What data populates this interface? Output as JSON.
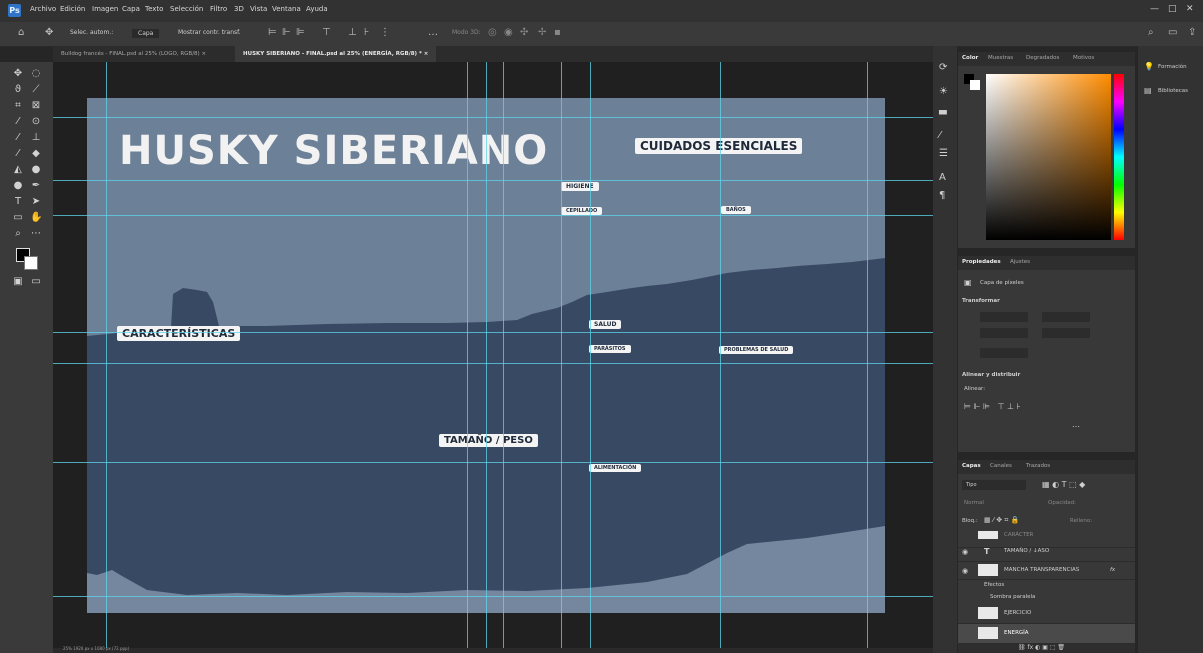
{
  "menu": [
    "Archivo",
    "Edición",
    "Imagen",
    "Capa",
    "Texto",
    "Selección",
    "Filtro",
    "3D",
    "Vista",
    "Ventana",
    "Ayuda"
  ],
  "window_controls": {
    "minimize": "—",
    "maximize": "□",
    "close": "✕"
  },
  "options_bar": {
    "auto_select_label": "Selec. autom.:",
    "auto_select_value": "Capa",
    "transform_controls_label": "Mostrar contr. transf.",
    "mode_3d_label": "Modo 3D:"
  },
  "tabs": [
    {
      "label": "Bulldog francés - FINAL.psd al 25% (LOGO, RGB/8)",
      "close": "×"
    },
    {
      "label": "HUSKY SIBERIANO - FINAL.psd al 25% (ENERGÍA, RGB/8) *",
      "close": "×"
    }
  ],
  "artboard": {
    "title": "HUSKY SIBERIANO",
    "labels": {
      "cuidados": "CUIDADOS ESENCIALES",
      "higiene": "HIGIENE",
      "cepillado": "CEPILLADO",
      "banos": "BAÑOS",
      "caracteristicas": "CARACTERÍSTICAS",
      "salud": "SALUD",
      "parasitos": "PARÁSITOS",
      "problemas": "PROBLEMAS DE SALUD",
      "tamano": "TAMAÑO / PESO",
      "alimentacion": "ALIMENTACIÓN"
    },
    "colors": {
      "sky": "#6c8097",
      "mountain": "#384963",
      "ground": "#74879e",
      "label_bg": "#f4f4f4"
    }
  },
  "color_panel": {
    "tabs": [
      "Color",
      "Muestras",
      "Degradados",
      "Motivos"
    ]
  },
  "properties_panel": {
    "tabs": [
      "Propiedades",
      "Ajustes"
    ],
    "layer_type": "Capa de píxeles",
    "transform_section": "Transformar",
    "align_section": "Alinear y distribuir",
    "align_label": "Alinear:"
  },
  "layers_panel": {
    "tabs": [
      "Capas",
      "Canales",
      "Trazados"
    ],
    "filter_label": "Tipo",
    "blend_label": "Normal",
    "opacity_label": "Opacidad:",
    "lock_label": "Bloq.:",
    "fill_label": "Relleno:",
    "layers": [
      {
        "name": "CARÁCTER"
      },
      {
        "name": "TAMAÑO / ↓ASO"
      },
      {
        "name": "MANCHA TRANSPARENCIAS",
        "fx": "fx"
      },
      {
        "name": "Efectos"
      },
      {
        "name": "Sombra paralela"
      },
      {
        "name": "EJERCICIO"
      },
      {
        "name": "ENERGÍA"
      }
    ]
  },
  "far_right": {
    "items": [
      "Formación",
      "Bibliotecas"
    ]
  },
  "status_bar": "25%   1920 px x 1080 px (72 ppp)"
}
